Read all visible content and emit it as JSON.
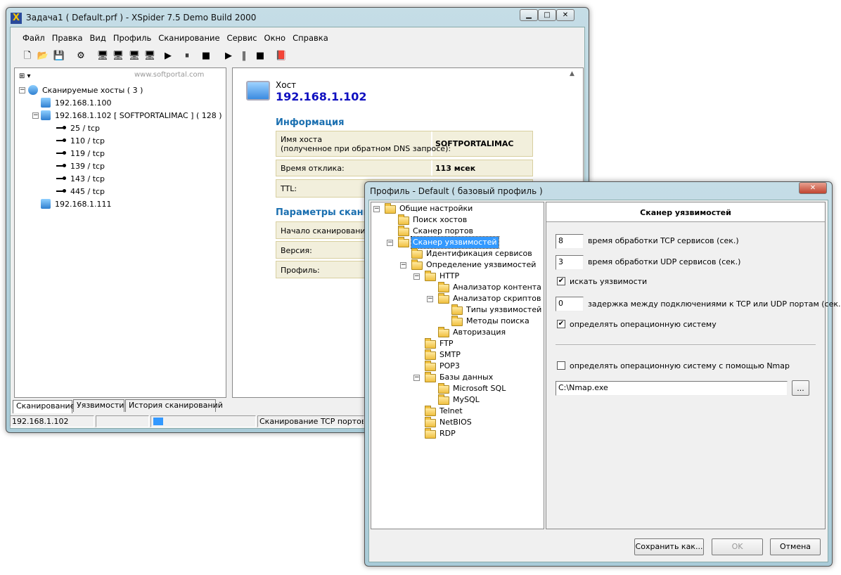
{
  "main": {
    "title": "Задача1 ( Default.prf ) - XSpider 7.5 Demo Build 2000",
    "menu": [
      "Файл",
      "Правка",
      "Вид",
      "Профиль",
      "Сканирование",
      "Сервис",
      "Окно",
      "Справка"
    ],
    "toolbar": [
      "new-icon",
      "open-icon",
      "save-icon",
      "settings-icon",
      "add-host-icon",
      "add-hosts-icon",
      "import-hosts-icon",
      "remove-host-icon",
      "start-selected-icon",
      "pause-selected-icon",
      "stop-selected-icon",
      "start-icon",
      "pause-icon",
      "stop-icon",
      "help-book-icon"
    ],
    "tree": [
      {
        "label": "Сканируемые хосты ( 3 )",
        "level": 0,
        "icon": "globe"
      },
      {
        "label": "192.168.1.100",
        "level": 1,
        "icon": "host"
      },
      {
        "label": "192.168.1.102 [ SOFTPORTALIMAC ] ( 128 )",
        "level": 1,
        "icon": "host-scanning"
      },
      {
        "label": "25 / tcp",
        "level": 2,
        "icon": "port"
      },
      {
        "label": "110 / tcp",
        "level": 2,
        "icon": "port"
      },
      {
        "label": "119 / tcp",
        "level": 2,
        "icon": "port"
      },
      {
        "label": "139 / tcp",
        "level": 2,
        "icon": "port"
      },
      {
        "label": "143 / tcp",
        "level": 2,
        "icon": "port"
      },
      {
        "label": "445 / tcp",
        "level": 2,
        "icon": "port"
      },
      {
        "label": "192.168.1.111",
        "level": 1,
        "icon": "host"
      }
    ],
    "host_label": "Хост",
    "host_ip": "192.168.1.102",
    "info_title": "Информация",
    "info": [
      {
        "label": "Имя хоста",
        "label2": "(полученное при обратном DNS запросе):",
        "value": "SOFTPORTALIMAC"
      },
      {
        "label": "Время отклика:",
        "value": "113 мсек"
      },
      {
        "label": "TTL:",
        "value": ""
      }
    ],
    "params_title": "Параметры сканирования",
    "params": [
      {
        "label": "Начало сканирования:"
      },
      {
        "label": "Версия:"
      },
      {
        "label": "Профиль:"
      }
    ],
    "tabs": [
      "Сканирование",
      "Уязвимости",
      "История сканирований"
    ],
    "status": {
      "host": "192.168.1.102",
      "progress_percent": 5,
      "text": "Сканирование TCP портов"
    },
    "watermark": "www.softportal.com"
  },
  "dialog": {
    "title": "Профиль - Default   ( базовый профиль )",
    "tree": [
      {
        "label": "Общие настройки",
        "level": 0,
        "exp": "-"
      },
      {
        "label": "Поиск хостов",
        "level": 1
      },
      {
        "label": "Сканер портов",
        "level": 1
      },
      {
        "label": "Сканер уязвимостей",
        "level": 1,
        "exp": "-",
        "selected": true
      },
      {
        "label": "Идентификация сервисов",
        "level": 2
      },
      {
        "label": "Определение уязвимостей",
        "level": 2,
        "exp": "-"
      },
      {
        "label": "HTTP",
        "level": 3,
        "exp": "-"
      },
      {
        "label": "Анализатор контента",
        "level": 4
      },
      {
        "label": "Анализатор скриптов",
        "level": 4,
        "exp": "-"
      },
      {
        "label": "Типы уязвимостей",
        "level": 5
      },
      {
        "label": "Методы поиска",
        "level": 5
      },
      {
        "label": "Авторизация",
        "level": 4
      },
      {
        "label": "FTP",
        "level": 3
      },
      {
        "label": "SMTP",
        "level": 3
      },
      {
        "label": "POP3",
        "level": 3
      },
      {
        "label": "Базы данных",
        "level": 3,
        "exp": "-"
      },
      {
        "label": "Microsoft SQL",
        "level": 4
      },
      {
        "label": "MySQL",
        "level": 4
      },
      {
        "label": "Telnet",
        "level": 3
      },
      {
        "label": "NetBIOS",
        "level": 3
      },
      {
        "label": "RDP",
        "level": 3
      }
    ],
    "panel_title": "Сканер уязвимостей",
    "tcp_time": "8",
    "tcp_time_label": "время обработки TCP сервисов (сек.)",
    "udp_time": "3",
    "udp_time_label": "время обработки UDP сервисов (сек.)",
    "find_vulns": {
      "label": "искать уязвимости",
      "checked": true
    },
    "delay": "0",
    "delay_label": "задержка между подключениями к TCP или UDP портам (сек.)",
    "detect_os": {
      "label": "определять операционную систему",
      "checked": true
    },
    "nmap": {
      "label": "определять операционную систему с помощью Nmap",
      "checked": false
    },
    "nmap_path": "C:\\Nmap.exe",
    "browse": "...",
    "save_as": "Сохранить как...",
    "ok": "OK",
    "cancel": "Отмена"
  },
  "colors": {
    "accent": "#1a6fb0",
    "host_ip": "#1010c0",
    "selection": "#3399ff",
    "progress": "#3399ff"
  }
}
